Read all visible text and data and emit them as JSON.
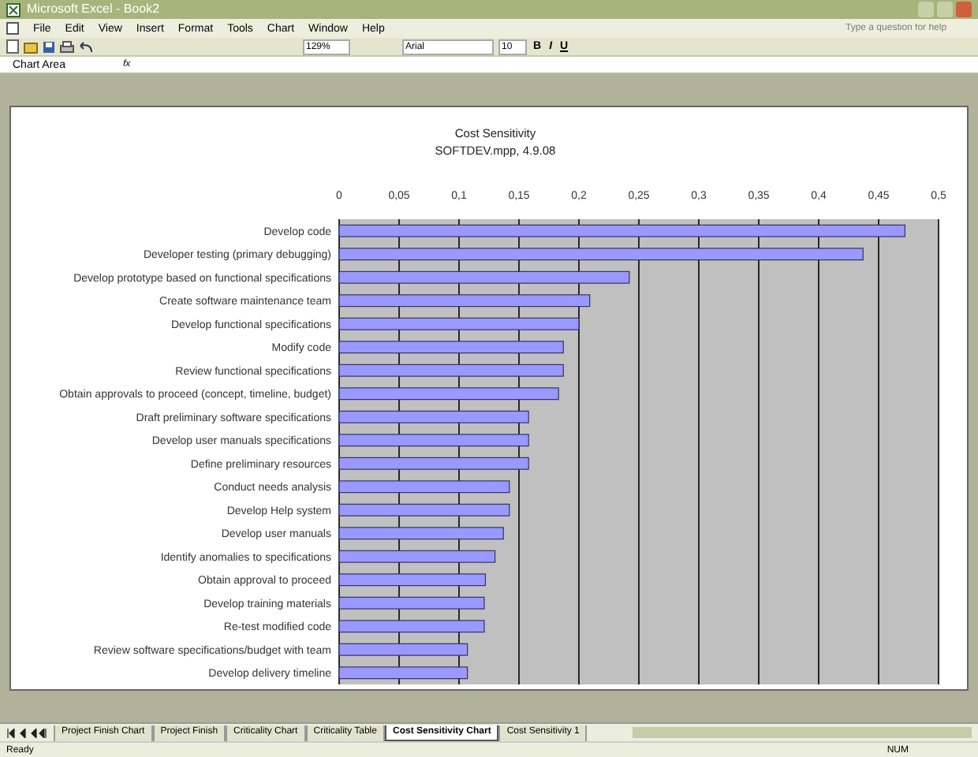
{
  "window": {
    "title": "Microsoft Excel - Book2"
  },
  "menu": [
    "File",
    "Edit",
    "View",
    "Insert",
    "Format",
    "Tools",
    "Chart",
    "Window",
    "Help"
  ],
  "help_box": {
    "placeholder": "Type a question for help"
  },
  "toolbar": {
    "zoom": "129%",
    "font": "Arial",
    "size": "10",
    "bold": "B",
    "italic": "I",
    "underline": "U"
  },
  "formula_bar": {
    "name_box": "Chart Area",
    "fx": "fx"
  },
  "chart": {
    "chart_data": {
      "type": "bar",
      "orientation": "horizontal",
      "title": "Cost Sensitivity\nSOFTDEV.mpp, 4.9.08",
      "categories": [
        "Develop code",
        "Developer testing (primary debugging)",
        "Develop prototype based on functional specifications",
        "Create software maintenance team",
        "Develop functional specifications",
        "Modify code",
        "Review functional specifications",
        "Obtain approvals to proceed (concept, timeline, budget)",
        "Draft preliminary software specifications",
        "Develop user manuals specifications",
        "Define preliminary resources",
        "Conduct needs analysis",
        "Develop Help system",
        "Develop user manuals",
        "Identify anomalies to specifications",
        "Obtain approval to proceed",
        "Develop training materials",
        "Re-test modified code",
        "Review software specifications/budget with team",
        "Develop delivery timeline"
      ],
      "series": [
        {
          "color": "#9999ff",
          "values": [
            0.472,
            0.437,
            0.242,
            0.209,
            0.2,
            0.187,
            0.187,
            0.183,
            0.158,
            0.158,
            0.158,
            0.142,
            0.142,
            0.137,
            0.13,
            0.122,
            0.121,
            0.121,
            0.107,
            0.107
          ]
        }
      ],
      "xlim": [
        0,
        0.5
      ],
      "grid": {
        "x": true
      },
      "xticks": [
        {
          "value": 0,
          "label": "0"
        },
        {
          "value": 0.05,
          "label": "0,05"
        },
        {
          "value": 0.1,
          "label": "0,1"
        },
        {
          "value": 0.15,
          "label": "0,15"
        },
        {
          "value": 0.2,
          "label": "0,2"
        },
        {
          "value": 0.25,
          "label": "0,25"
        },
        {
          "value": 0.3,
          "label": "0,3"
        },
        {
          "value": 0.35,
          "label": "0,35"
        },
        {
          "value": 0.4,
          "label": "0,4"
        },
        {
          "value": 0.45,
          "label": "0,45"
        },
        {
          "value": 0.5,
          "label": "0,5"
        }
      ]
    }
  },
  "sheet_tabs": [
    {
      "label": "Project Finish Chart",
      "selected": false
    },
    {
      "label": "Project Finish",
      "selected": false
    },
    {
      "label": "Criticality Chart",
      "selected": false
    },
    {
      "label": "Criticality Table",
      "selected": false
    },
    {
      "label": "Cost Sensitivity Chart",
      "selected": true
    },
    {
      "label": "Cost Sensitivity 1",
      "selected": false
    }
  ],
  "status_bar": {
    "status": "Ready",
    "num": "NUM"
  }
}
